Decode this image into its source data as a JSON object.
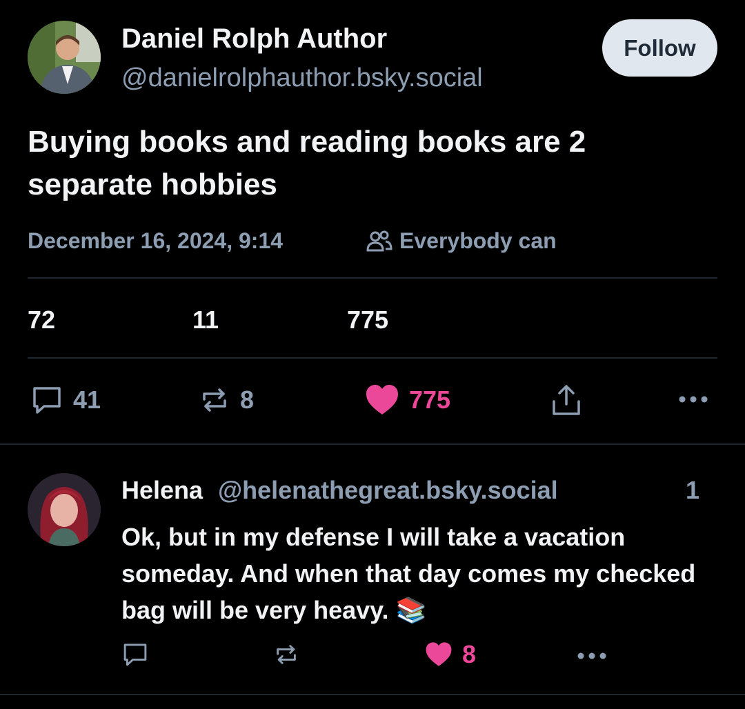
{
  "post": {
    "author_name": "Daniel Rolph Author",
    "author_handle": "@danielrolphauthor.bsky.social",
    "follow_label": "Follow",
    "text": "Buying books and reading books are 2 separate hobbies",
    "date": "December 16, 2024, 9:14",
    "audience_label": "Everybody can",
    "audience_icon": "people-icon",
    "stats": [
      "72",
      "11",
      "775"
    ],
    "actions": {
      "reply_count": "41",
      "repost_count": "8",
      "like_count": "775",
      "liked": true
    }
  },
  "reply": {
    "author_name": "Helena",
    "author_handle": "@helenathegreat.bsky.social",
    "time": "1",
    "text": "Ok, but in my defense I will take a vacation someday. And when that day comes my checked bag will be very heavy. 📚",
    "actions": {
      "like_count": "8",
      "liked": true
    }
  },
  "colors": {
    "background": "#000000",
    "muted_text": "#8d9eb3",
    "like_pink": "#ec4899",
    "follow_button_bg": "#e1e7ee"
  }
}
